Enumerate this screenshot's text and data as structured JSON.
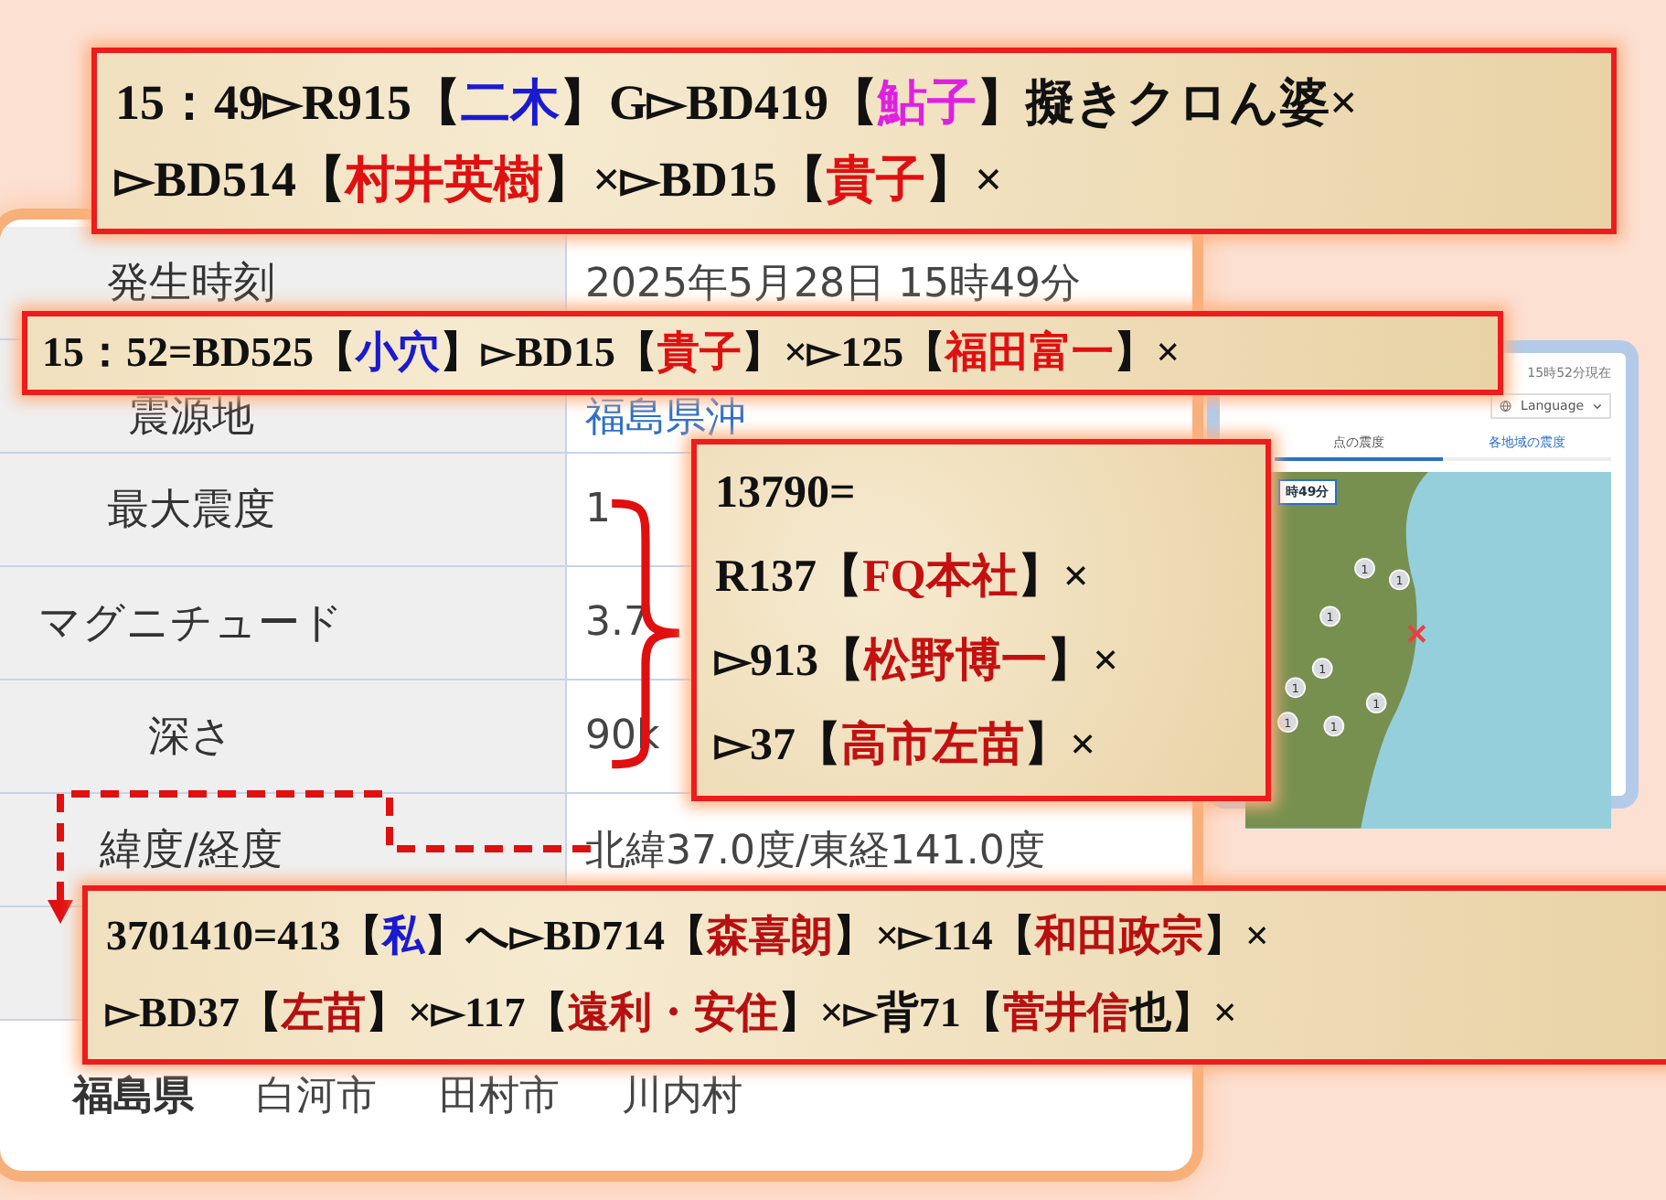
{
  "quake_table": {
    "rows": [
      {
        "label": "発生時刻",
        "value": "2025年5月28日 15時49分",
        "kind": "plain"
      },
      {
        "label": "震源地",
        "value": "福島県沖",
        "kind": "link"
      },
      {
        "label": "最大震度",
        "value": "1",
        "kind": "plain"
      },
      {
        "label": "マグニチュード",
        "value": "3.7",
        "kind": "plain"
      },
      {
        "label": "深さ",
        "value": "90k",
        "kind": "plain"
      },
      {
        "label": "緯度/経度",
        "value": "北緯37.0度/東経141.0度",
        "kind": "plain"
      },
      {
        "label": "",
        "value": "",
        "kind": "plain"
      }
    ],
    "region": {
      "prefecture": "福島県",
      "cities": [
        "白河市",
        "田村市",
        "川内村"
      ]
    }
  },
  "map_panel": {
    "updated": "15時52分現在",
    "language": "Language",
    "tabs": [
      {
        "label": "点の震度",
        "selected": true
      },
      {
        "label": "各地域の震度",
        "selected": false
      }
    ],
    "time_label": "時49分",
    "markers": [
      "1",
      "1",
      "1",
      "1",
      "1",
      "1",
      "1",
      "1"
    ]
  },
  "annotations": [
    {
      "lines": [
        [
          {
            "text": "15：49▻R915【",
            "color": "#111111"
          },
          {
            "text": "二木",
            "color": "#1a1ad0"
          },
          {
            "text": "】G▻BD419【",
            "color": "#111111"
          },
          {
            "text": "鮎子",
            "color": "#e020e0"
          },
          {
            "text": "】擬きクロん婆×",
            "color": "#111111"
          }
        ],
        [
          {
            "text": "▻BD514【",
            "color": "#111111"
          },
          {
            "text": "村井英樹",
            "color": "#e01010"
          },
          {
            "text": "】×▻BD15【",
            "color": "#111111"
          },
          {
            "text": "貴子",
            "color": "#e01010"
          },
          {
            "text": "】×",
            "color": "#111111"
          }
        ]
      ]
    },
    {
      "lines": [
        [
          {
            "text": "15：52=BD525【",
            "color": "#111111"
          },
          {
            "text": "小穴",
            "color": "#1a1ad0"
          },
          {
            "text": "】▻BD15【",
            "color": "#111111"
          },
          {
            "text": "貴子",
            "color": "#e01010"
          },
          {
            "text": "】×▻125【",
            "color": "#111111"
          },
          {
            "text": "福田富一",
            "color": "#e01010"
          },
          {
            "text": "】×",
            "color": "#111111"
          }
        ]
      ]
    },
    {
      "lines": [
        [
          {
            "text": "13790=",
            "color": "#111111"
          }
        ],
        [
          {
            "text": "R137【",
            "color": "#111111"
          },
          {
            "text": "FQ本社",
            "color": "#c41010"
          },
          {
            "text": "】×",
            "color": "#111111"
          }
        ],
        [
          {
            "text": "▻913【",
            "color": "#111111"
          },
          {
            "text": "松野博一",
            "color": "#c41010"
          },
          {
            "text": "】×",
            "color": "#111111"
          }
        ],
        [
          {
            "text": "▻37【",
            "color": "#111111"
          },
          {
            "text": "高市左苗",
            "color": "#c41010"
          },
          {
            "text": "】×",
            "color": "#111111"
          }
        ]
      ]
    },
    {
      "lines": [
        [
          {
            "text": "3701410=413【",
            "color": "#111111"
          },
          {
            "text": "私",
            "color": "#1a1ad0"
          },
          {
            "text": "】へ▻BD714【",
            "color": "#111111"
          },
          {
            "text": "森喜朗",
            "color": "#b81010"
          },
          {
            "text": "】×▻114【",
            "color": "#111111"
          },
          {
            "text": "和田政宗",
            "color": "#b81010"
          },
          {
            "text": "】×",
            "color": "#111111"
          }
        ],
        [
          {
            "text": "▻BD37【",
            "color": "#111111"
          },
          {
            "text": "左苗",
            "color": "#b81010"
          },
          {
            "text": "】×▻117【",
            "color": "#111111"
          },
          {
            "text": "遠利・安住",
            "color": "#b81010"
          },
          {
            "text": "】×▻背71【",
            "color": "#111111"
          },
          {
            "text": "菅井信",
            "color": "#b81010"
          },
          {
            "text": "也",
            "color": "#111111"
          },
          {
            "text": "】×",
            "color": "#111111"
          }
        ]
      ]
    }
  ]
}
